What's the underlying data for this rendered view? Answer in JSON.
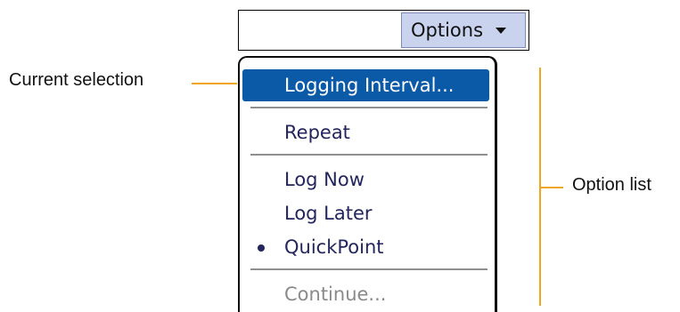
{
  "toolbar": {
    "options_label": "Options"
  },
  "menu": {
    "items": [
      {
        "label": "Logging Interval...",
        "state": "selected"
      },
      {
        "label": "Repeat",
        "state": "normal"
      },
      {
        "label": "Log Now",
        "state": "normal"
      },
      {
        "label": "Log Later",
        "state": "normal"
      },
      {
        "label": "QuickPoint",
        "state": "checked"
      },
      {
        "label": "Continue...",
        "state": "disabled"
      }
    ]
  },
  "annotations": {
    "current_selection": "Current selection",
    "option_list": "Option list"
  },
  "colors": {
    "selection_bg": "#0a5aa8",
    "callout_line": "#f0a51e",
    "options_button_bg": "#c9d3ee",
    "menu_text": "#22255e",
    "disabled_text": "#8a8a8a"
  }
}
